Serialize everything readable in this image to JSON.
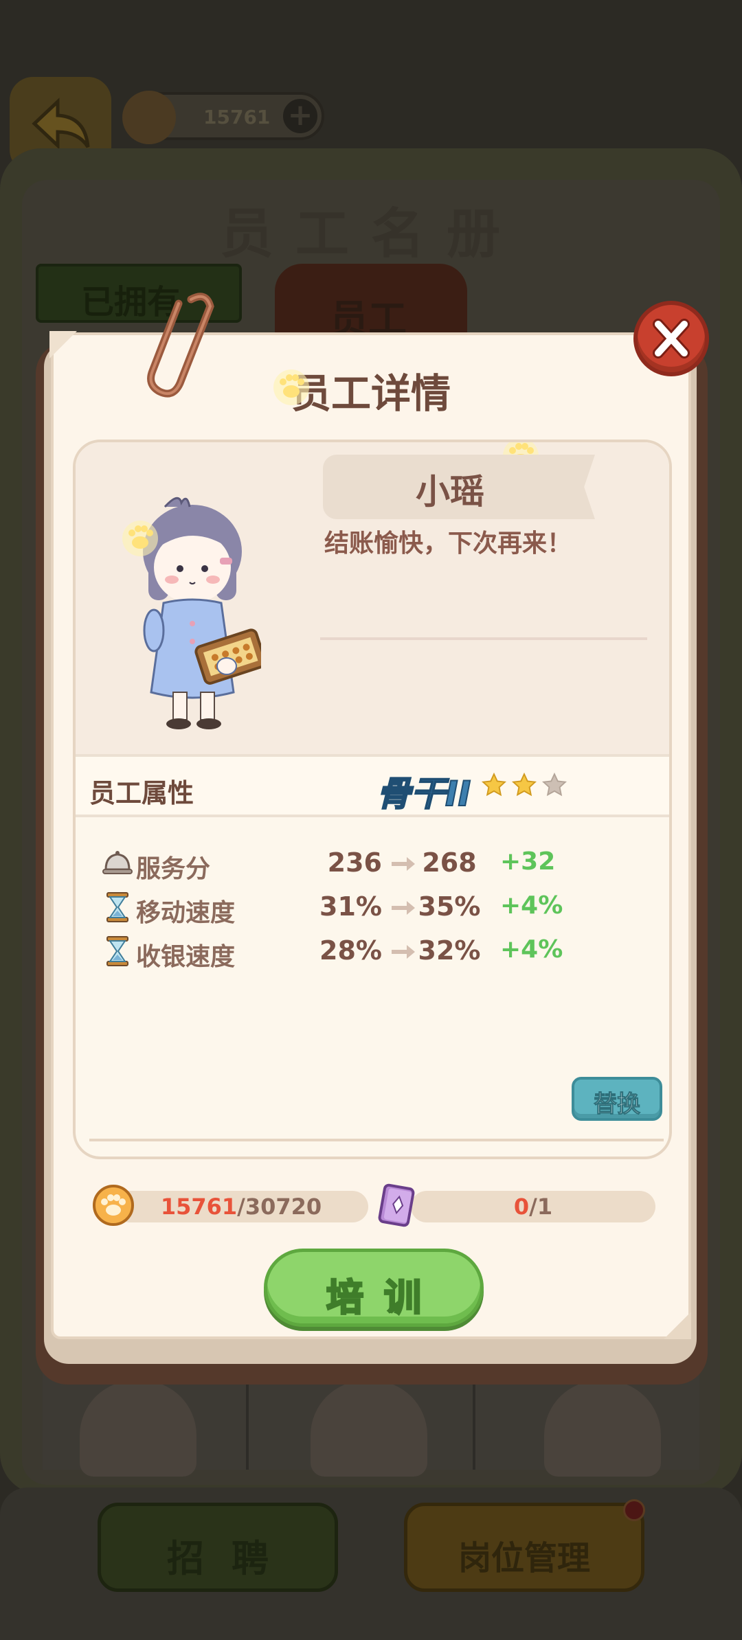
{
  "top_bar": {
    "coins": "15761"
  },
  "background": {
    "roster_title": "员工名册",
    "tab_owned": "已拥有",
    "tab_staff": "员工",
    "recruit_label": "招聘",
    "post_management_label": "岗位管理"
  },
  "modal": {
    "title": "员工详情",
    "employee": {
      "name": "小瑶",
      "motto": "结账愉快，下次再来！"
    },
    "attributes": {
      "label": "员工属性",
      "rank": "骨干II",
      "stars_filled": 2,
      "stars_total": 3
    },
    "stats": [
      {
        "icon": "service-bell-icon",
        "name": "服务分",
        "current": "236",
        "next": "268",
        "delta": "+32"
      },
      {
        "icon": "hourglass-icon",
        "name": "移动速度",
        "current": "31%",
        "next": "35%",
        "delta": "+4%"
      },
      {
        "icon": "hourglass-icon",
        "name": "收银速度",
        "current": "28%",
        "next": "32%",
        "delta": "+4%"
      }
    ],
    "swap_label": "替换",
    "resources": {
      "coins": {
        "have": "15761",
        "need": "/30720"
      },
      "books": {
        "have": "0",
        "need": "/1"
      }
    },
    "train_label": "培训"
  },
  "colors": {
    "accent_green": "#8ed56b",
    "delta_green": "#5ec45a",
    "close_red": "#c8402e",
    "rank_blue": "#3d7fae",
    "have_red": "#e8533a"
  }
}
